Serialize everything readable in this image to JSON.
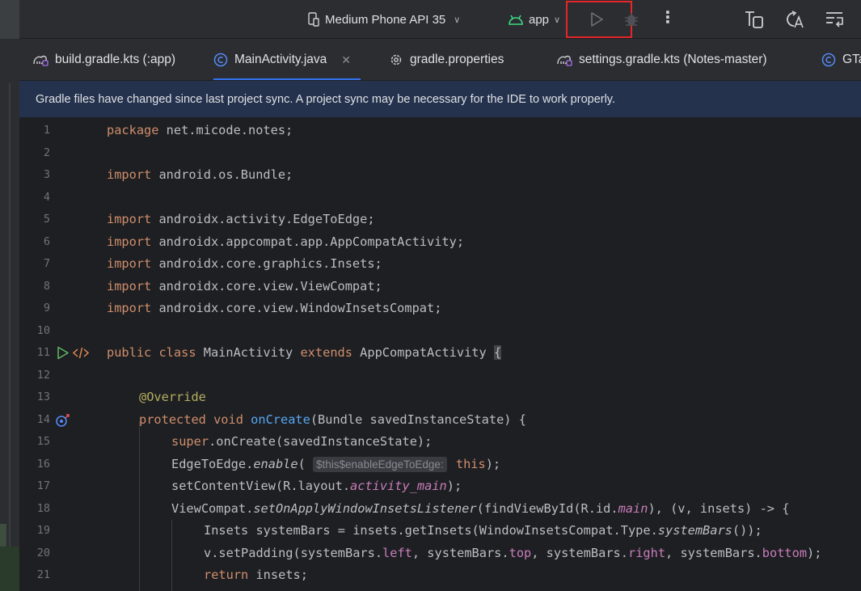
{
  "toolbar": {
    "device": "Medium Phone API 35",
    "config": "app"
  },
  "tabs": [
    {
      "label": "build.gradle.kts (:app)",
      "icon": "gradle-icon",
      "active": false
    },
    {
      "label": "MainActivity.java",
      "icon": "java-class-icon",
      "active": true
    },
    {
      "label": "gradle.properties",
      "icon": "gear-icon",
      "active": false
    },
    {
      "label": "settings.gradle.kts (Notes-master)",
      "icon": "gradle-icon",
      "active": false
    },
    {
      "label": "GTa",
      "icon": "java-class-icon",
      "active": false
    }
  ],
  "banner": {
    "message": "Gradle files have changed since last project sync. A project sync may be necessary for the IDE to work properly."
  },
  "editor": {
    "line_numbers": [
      "1",
      "2",
      "3",
      "4",
      "5",
      "6",
      "7",
      "8",
      "9",
      "10",
      "11",
      "12",
      "13",
      "14",
      "15",
      "16",
      "17",
      "18",
      "19",
      "20",
      "21"
    ],
    "code": {
      "l1_kw": "package",
      "l1_rest": " net.micode.notes;",
      "import_kw": "import",
      "l3": " android.os.Bundle;",
      "l5": " androidx.activity.EdgeToEdge;",
      "l6": " androidx.appcompat.app.AppCompatActivity;",
      "l7": " androidx.core.graphics.Insets;",
      "l8": " androidx.core.view.ViewCompat;",
      "l9": " androidx.core.view.WindowInsetsCompat;",
      "l11_public": "public",
      "l11_class": " class",
      "l11_name": " MainActivity",
      "l11_extends": " extends",
      "l11_super": " AppCompatActivity ",
      "l11_brace": "{",
      "l13": "@Override",
      "l14_protected": "protected",
      "l14_void": " void",
      "l14_method": " onCreate",
      "l14_rest": "(Bundle savedInstanceState) {",
      "l15_super": "super",
      "l15_rest": ".onCreate(savedInstanceState);",
      "l16_cls": "EdgeToEdge.",
      "l16_method": "enable",
      "l16_open": "(",
      "l16_hint": "$this$enableEdgeToEdge:",
      "l16_this": " this",
      "l16_close": ");",
      "l17_a": "setContentView(R.layout.",
      "l17_field": "activity_main",
      "l17_b": ");",
      "l18_a": "ViewCompat.",
      "l18_method": "setOnApplyWindowInsetsListener",
      "l18_b": "(findViewById(R.id.",
      "l18_field": "main",
      "l18_c": "), (v, insets) -> {",
      "l19_a": "Insets systemBars = insets.getInsets(WindowInsetsCompat.Type.",
      "l19_method": "systemBars",
      "l19_b": "());",
      "l20_a": "v.setPadding(systemBars.",
      "l20_left": "left",
      "l20_s1": ", systemBars.",
      "l20_top": "top",
      "l20_s2": ", systemBars.",
      "l20_right": "right",
      "l20_s3": ", systemBars.",
      "l20_bottom": "bottom",
      "l20_end": ");",
      "l21_kw": "return",
      "l21_rest": " insets;"
    }
  },
  "colors": {
    "keyword": "#cf8e6d",
    "annotation": "#b3ae60",
    "method": "#56a8f5",
    "field": "#c77dbb",
    "highlight_box": "#e5262a",
    "active_tab_underline": "#3574f0"
  }
}
